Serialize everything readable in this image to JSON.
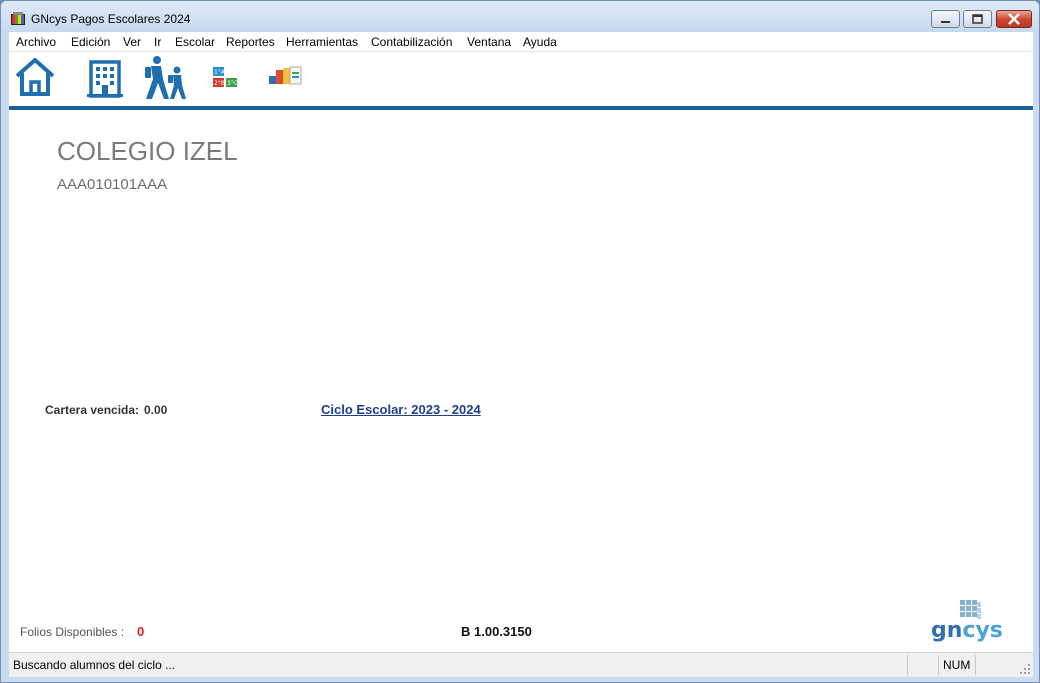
{
  "window": {
    "title": "GNcys Pagos Escolares 2024"
  },
  "menu": {
    "items": [
      "Archivo",
      "Edición",
      "Ver",
      "Ir",
      "Escolar",
      "Reportes",
      "Herramientas",
      "Contabilización",
      "Ventana",
      "Ayuda"
    ]
  },
  "toolbar": {
    "icons": [
      "home-icon",
      "building-icon",
      "students-walking-icon",
      "grades-icon",
      "payments-icon"
    ],
    "grades_labels": [
      "1°A",
      "2°B",
      "3°C"
    ]
  },
  "school": {
    "name": "COLEGIO IZEL",
    "rfc": "AAA010101AAA"
  },
  "summary": {
    "cartera_label": "Cartera vencida:",
    "cartera_value": "0.00",
    "ciclo_link": "Ciclo Escolar: 2023 - 2024"
  },
  "footer": {
    "folios_label": "Folios Disponibles :",
    "folios_value": "0",
    "version": "B 1.00.3150",
    "logo_text_a": "gn",
    "logo_text_b": "cys"
  },
  "statusbar": {
    "message": "Buscando alumnos del ciclo ...",
    "num_indicator": "NUM"
  },
  "colors": {
    "accent_bar": "#1f5f97",
    "icon_blue": "#1f6fb0",
    "folios_value": "#e02020",
    "link": "#1f3f8f"
  }
}
